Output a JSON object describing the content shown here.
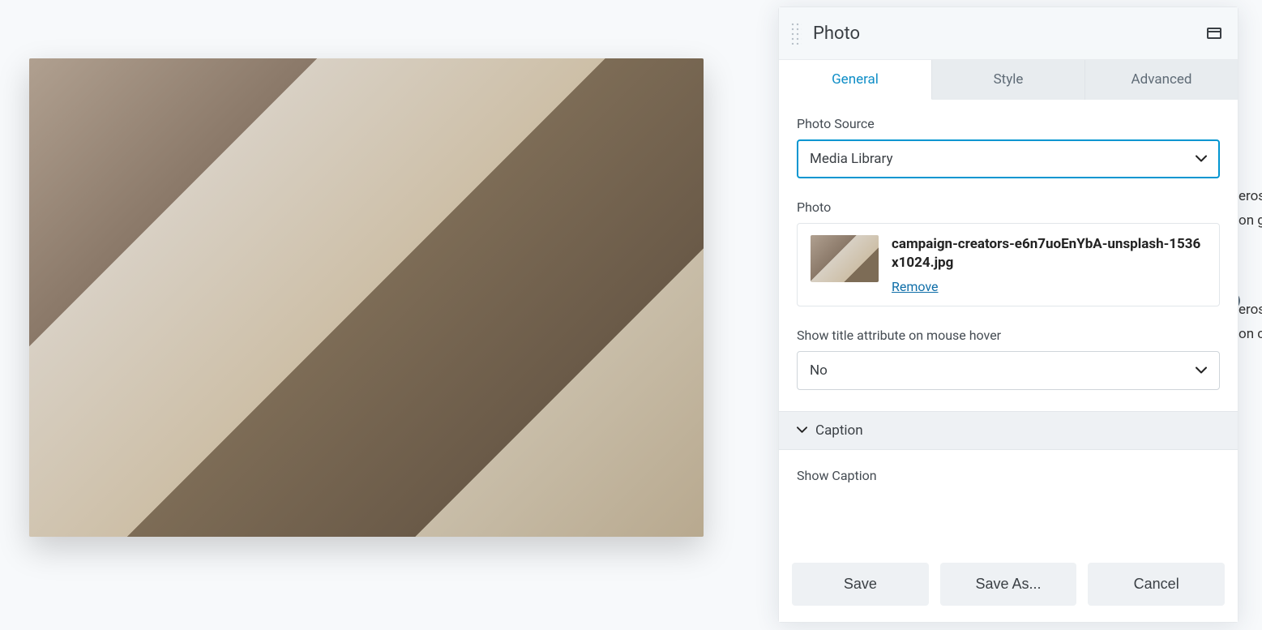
{
  "panel": {
    "title": "Photo",
    "tabs": {
      "general": "General",
      "style": "Style",
      "advanced": "Advanced"
    }
  },
  "fields": {
    "photo_source": {
      "label": "Photo Source",
      "value": "Media Library"
    },
    "photo": {
      "label": "Photo",
      "filename": "campaign-creators-e6n7uoEnYbA-unsplash-1536x1024.jpg",
      "remove": "Remove"
    },
    "title_hover": {
      "label": "Show title attribute on mouse hover",
      "value": "No"
    },
    "caption_section": "Caption",
    "show_caption": {
      "label": "Show Caption"
    }
  },
  "footer": {
    "save": "Save",
    "save_as": "Save As...",
    "cancel": "Cancel"
  },
  "background_text": {
    "line1": "eros",
    "line2": "on g",
    "line3": "eros",
    "line4": "on c"
  }
}
